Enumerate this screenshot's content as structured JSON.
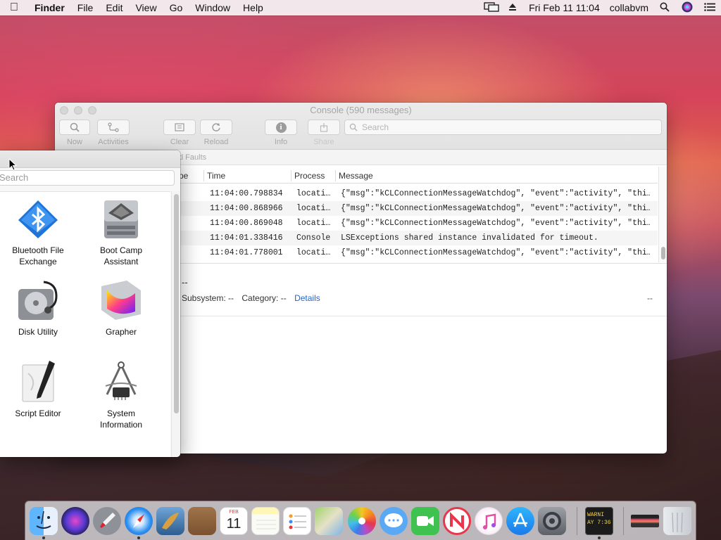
{
  "menubar": {
    "app_name": "Finder",
    "menus": [
      "File",
      "Edit",
      "View",
      "Go",
      "Window",
      "Help"
    ],
    "clock": "Fri Feb 11  11:04",
    "user": "collabvm"
  },
  "console": {
    "title": "Console (590 messages)",
    "toolbar": {
      "now": "Now",
      "activities": "Activities",
      "clear": "Clear",
      "reload": "Reload",
      "info": "Info",
      "share": "Share",
      "search_placeholder": "Search"
    },
    "filter_text": "d Faults",
    "columns": [
      "pe",
      "Time",
      "Process",
      "Message"
    ],
    "rows": [
      {
        "time": "11:04:00.798834",
        "process": "locati…",
        "message": "{\"msg\":\"kCLConnectionMessageWatchdog\", \"event\":\"activity\", \"thi…"
      },
      {
        "time": "11:04:00.868966",
        "process": "locati…",
        "message": "{\"msg\":\"kCLConnectionMessageWatchdog\", \"event\":\"activity\", \"thi…"
      },
      {
        "time": "11:04:00.869048",
        "process": "locati…",
        "message": "{\"msg\":\"kCLConnectionMessageWatchdog\", \"event\":\"activity\", \"thi…"
      },
      {
        "time": "11:04:01.338416",
        "process": "Console",
        "message": "LSExceptions shared instance invalidated for timeout."
      },
      {
        "time": "11:04:01.778001",
        "process": "locati…",
        "message": "{\"msg\":\"kCLConnectionMessageWatchdog\", \"event\":\"activity\", \"thi…"
      }
    ],
    "detail": {
      "header": "--",
      "subsystem_label": "Subsystem: --",
      "category_label": "Category: --",
      "details_link": "Details",
      "trailing": "--"
    }
  },
  "utilities": {
    "search_placeholder": "Search",
    "apps": [
      {
        "line1": "Bluetooth File",
        "line2": "Exchange",
        "icon": "bluetooth-icon"
      },
      {
        "line1": "Boot Camp",
        "line2": "Assistant",
        "icon": "boot-camp-icon"
      },
      {
        "line1": "Disk Utility",
        "line2": "",
        "icon": "disk-utility-icon"
      },
      {
        "line1": "Grapher",
        "line2": "",
        "icon": "grapher-icon"
      },
      {
        "line1": "Script Editor",
        "line2": "",
        "icon": "script-editor-icon"
      },
      {
        "line1": "System",
        "line2": "Information",
        "icon": "system-information-icon"
      }
    ]
  },
  "dock": {
    "calendar_month": "FEB",
    "calendar_day": "11",
    "console_icon_text1": "WARNI",
    "console_icon_text2": "AY 7:36"
  },
  "colors": {
    "accent_link": "#2765c5",
    "finder_blue": "#3a8ef0"
  }
}
